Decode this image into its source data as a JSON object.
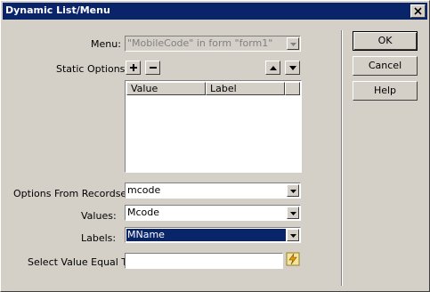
{
  "window": {
    "title": "Dynamic List/Menu"
  },
  "menu": {
    "label": "Menu:",
    "value": "\"MobileCode\" in form \"form1\""
  },
  "static_options": {
    "label": "Static Options:",
    "columns": [
      "Value",
      "Label"
    ],
    "rows": []
  },
  "recordset": {
    "label": "Options From Recordset:",
    "value": "mcode"
  },
  "values_field": {
    "label": "Values:",
    "value": "Mcode"
  },
  "labels_field": {
    "label": "Labels:",
    "value": "MName"
  },
  "select_value": {
    "label": "Select Value Equal To:",
    "value": ""
  },
  "buttons": {
    "ok": "OK",
    "cancel": "Cancel",
    "help": "Help"
  },
  "colors": {
    "titlebar": "#0a246a",
    "selection": "#0a246a",
    "face": "#d4d0c8"
  },
  "icons": [
    "close-icon",
    "add-icon",
    "remove-icon",
    "move-up-icon",
    "move-down-icon",
    "chevron-down-icon",
    "dynamic-data-icon"
  ]
}
